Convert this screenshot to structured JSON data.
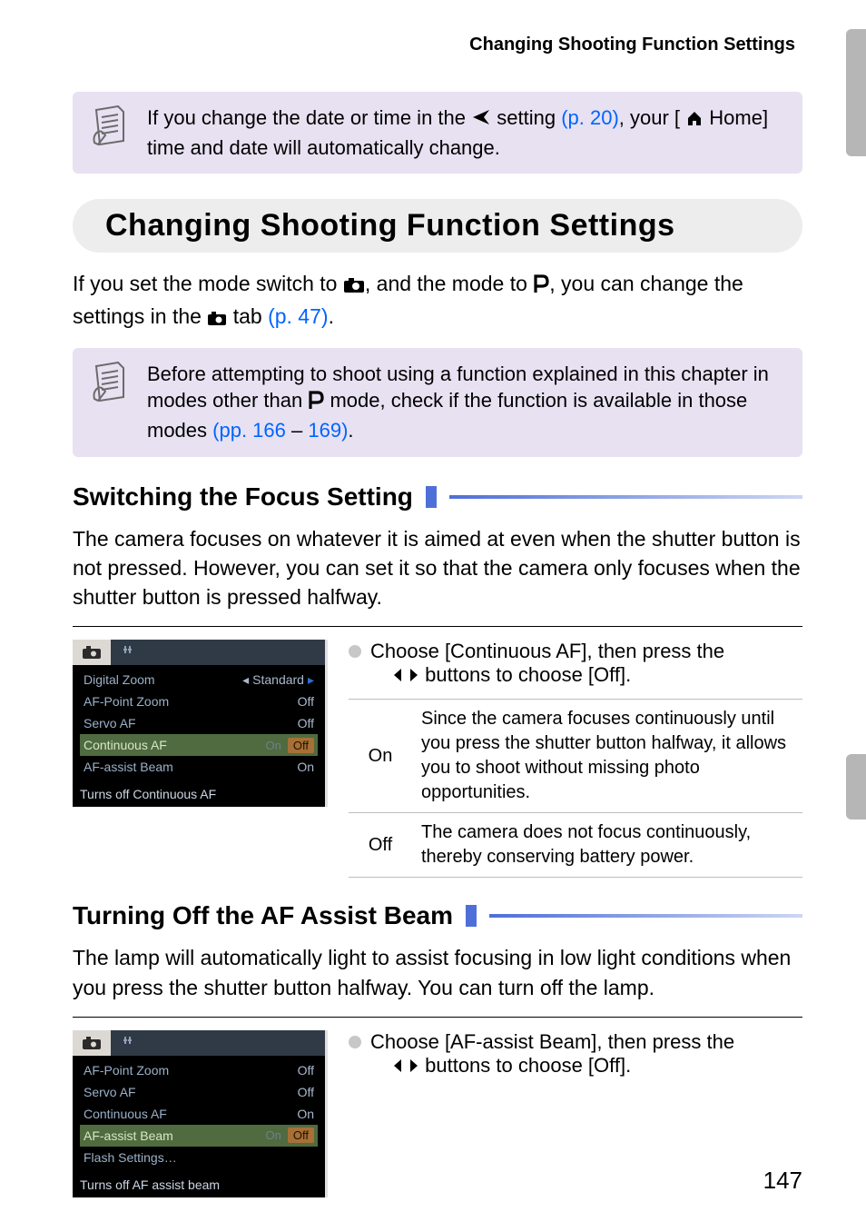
{
  "running_head": "Changing Shooting Function Settings",
  "note1": {
    "pre": "If you change the date or time in the ",
    "link": "(p. 20)",
    "mid": " setting ",
    "post1": ", your [",
    "post2": " Home] time and date will automatically change."
  },
  "section_title": "Changing Shooting Function Settings",
  "intro": {
    "a": "If you set the mode switch to ",
    "b": ", and the mode to ",
    "c": ", you can change the settings in the ",
    "d": " tab ",
    "link": "(p. 47)",
    "e": "."
  },
  "note2": {
    "a": "Before attempting to shoot using a function explained in this chapter in modes other than ",
    "b": " mode, check if the function is available in those modes ",
    "link1": "(pp. 166",
    "dash": " – ",
    "link2": "169)",
    "c": "."
  },
  "focus": {
    "heading": "Switching the Focus Setting",
    "body": "The camera focuses on whatever it is aimed at even when the shutter button is not pressed. However, you can set it so that the camera only focuses when the shutter button is pressed halfway.",
    "instr_a": "Choose [Continuous AF], then press the ",
    "instr_b": " buttons to choose [Off].",
    "table": [
      {
        "k": "On",
        "v": "Since the camera focuses continuously until you press the shutter button halfway, it allows you to shoot without missing photo opportunities."
      },
      {
        "k": "Off",
        "v": "The camera does not focus continuously, thereby conserving battery power."
      }
    ],
    "menu": {
      "rows": [
        {
          "label": "Digital Zoom",
          "value": "Standard",
          "arrows": true
        },
        {
          "label": "AF-Point Zoom",
          "value": "Off"
        },
        {
          "label": "Servo AF",
          "value": "Off"
        },
        {
          "label": "Continuous AF",
          "value_off": "Off",
          "value_on": "On",
          "selected": true
        },
        {
          "label": "AF-assist Beam",
          "value": "On"
        }
      ],
      "footer": "Turns off Continuous AF"
    }
  },
  "af_beam": {
    "heading": "Turning Off the AF Assist Beam",
    "body": "The lamp will automatically light to assist focusing in low light conditions when you press the shutter button halfway. You can turn off the lamp.",
    "instr_a": "Choose [AF-assist Beam], then press the ",
    "instr_b": " buttons to choose [Off].",
    "menu": {
      "rows": [
        {
          "label": "AF-Point Zoom",
          "value": "Off"
        },
        {
          "label": "Servo AF",
          "value": "Off"
        },
        {
          "label": "Continuous AF",
          "value": "On"
        },
        {
          "label": "AF-assist Beam",
          "value_off": "Off",
          "value_on": "On",
          "selected": true
        },
        {
          "label": "Flash Settings…",
          "value": ""
        }
      ],
      "footer": "Turns off AF assist beam"
    }
  },
  "page_number": "147"
}
